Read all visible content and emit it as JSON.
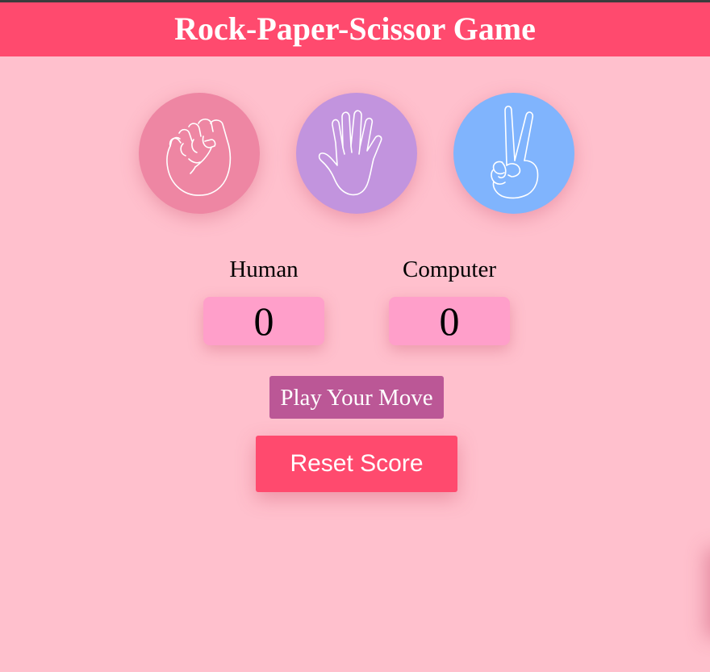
{
  "header": {
    "title": "Rock-Paper-Scissor Game"
  },
  "choices": [
    {
      "name": "rock",
      "icon": "fist-icon",
      "color": "#ee86a3"
    },
    {
      "name": "paper",
      "icon": "open-hand-icon",
      "color": "#c294de"
    },
    {
      "name": "scissor",
      "icon": "peace-hand-icon",
      "color": "#80b4fd"
    }
  ],
  "scores": {
    "human_label": "Human",
    "human_value": "0",
    "computer_label": "Computer",
    "computer_value": "0"
  },
  "buttons": {
    "play_label": "Play Your Move",
    "reset_label": "Reset Score"
  },
  "colors": {
    "background": "#ffc0cd",
    "header": "#ff4a6e",
    "score_box": "#ff9fca",
    "play_button": "#bb5796",
    "reset_button": "#ff4a6e"
  }
}
